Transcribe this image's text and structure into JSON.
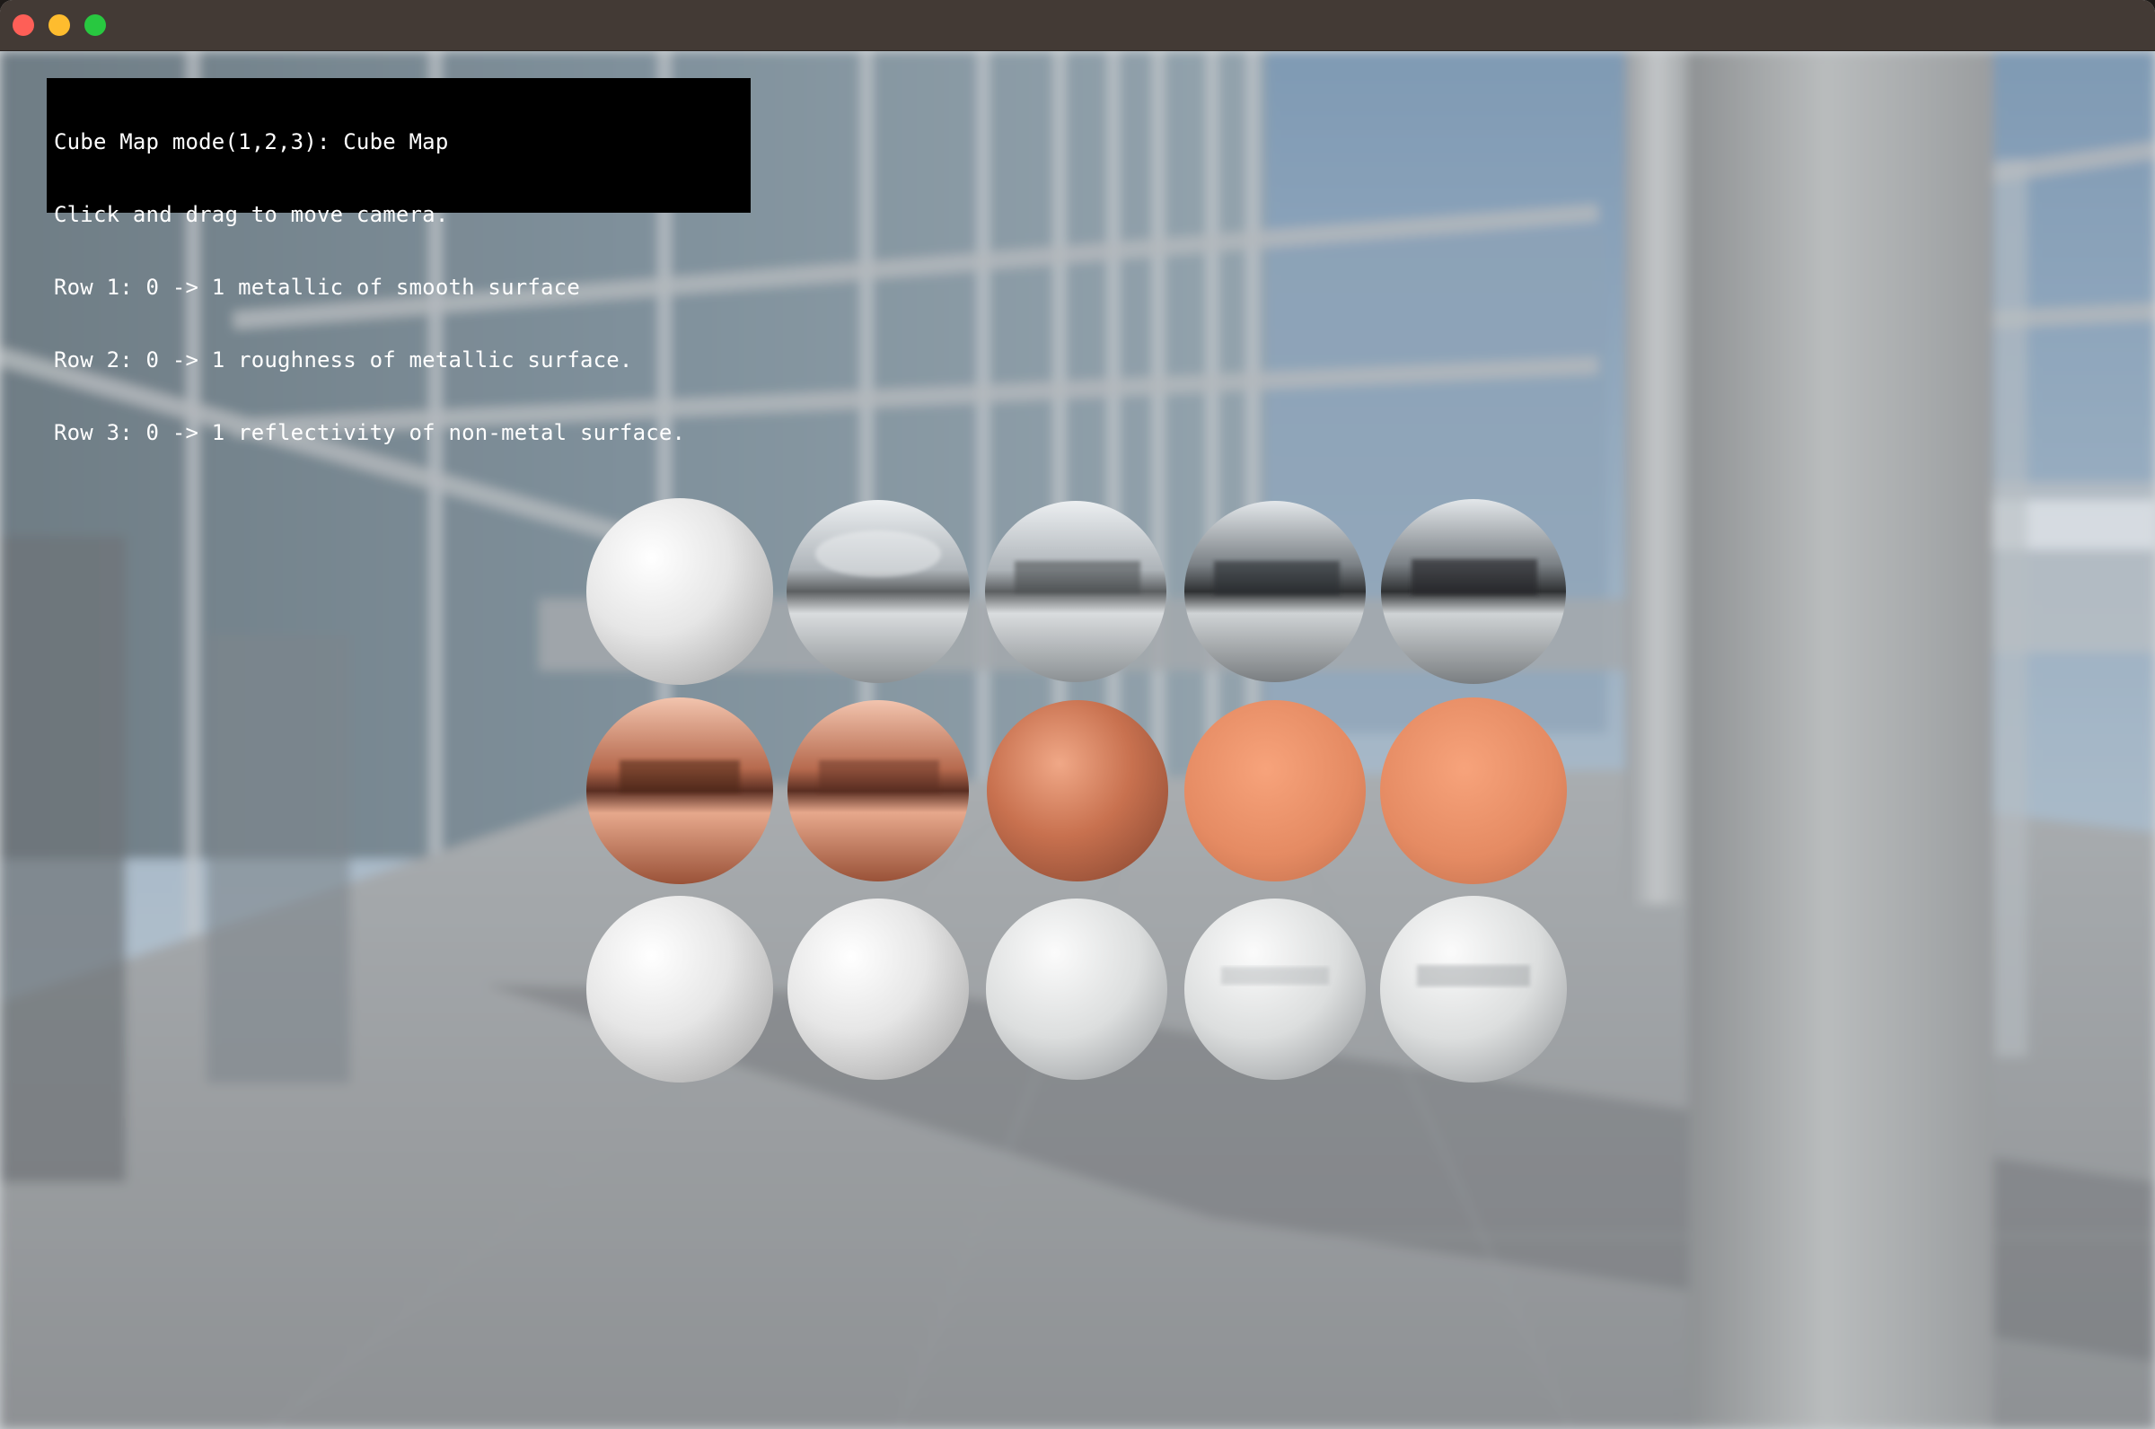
{
  "window": {
    "controls": {
      "close_color": "#fe5f57",
      "minimize_color": "#febc2e",
      "zoom_color": "#28c840"
    }
  },
  "overlay": {
    "lines": [
      "Cube Map mode(1,2,3): Cube Map",
      "Click and drag to move camera.",
      "Row 1: 0 -> 1 metallic of smooth surface",
      "Row 2: 0 -> 1 roughness of metallic surface.",
      "Row 3: 0 -> 1 reflectivity of non-metal surface."
    ]
  },
  "scene": {
    "spheres": [
      {
        "row": 1,
        "col": 1,
        "material": "smooth-white-dielectric",
        "color": "#e6e6e6",
        "metallic": 0.0
      },
      {
        "row": 1,
        "col": 2,
        "material": "chrome",
        "color": "#d5d9dc",
        "metallic": 0.25
      },
      {
        "row": 1,
        "col": 3,
        "material": "chrome",
        "color": "#c9cdd0",
        "metallic": 0.5
      },
      {
        "row": 1,
        "col": 4,
        "material": "chrome",
        "color": "#b5b9bc",
        "metallic": 0.75
      },
      {
        "row": 1,
        "col": 5,
        "material": "chrome",
        "color": "#a9adb0",
        "metallic": 1.0
      },
      {
        "row": 2,
        "col": 1,
        "material": "polished-copper",
        "color": "#c9785a",
        "roughness": 0.0
      },
      {
        "row": 2,
        "col": 2,
        "material": "polished-copper",
        "color": "#c97b5c",
        "roughness": 0.25
      },
      {
        "row": 2,
        "col": 3,
        "material": "brushed-copper",
        "color": "#d4805d",
        "roughness": 0.5
      },
      {
        "row": 2,
        "col": 4,
        "material": "matte-copper",
        "color": "#e58d66",
        "roughness": 0.75
      },
      {
        "row": 2,
        "col": 5,
        "material": "matte-copper",
        "color": "#eb9068",
        "roughness": 1.0
      },
      {
        "row": 3,
        "col": 1,
        "material": "white-dielectric",
        "color": "#e7e7e7",
        "reflectivity": 0.0
      },
      {
        "row": 3,
        "col": 2,
        "material": "white-dielectric",
        "color": "#e2e2e2",
        "reflectivity": 0.25
      },
      {
        "row": 3,
        "col": 3,
        "material": "white-dielectric",
        "color": "#dcdcdc",
        "reflectivity": 0.5
      },
      {
        "row": 3,
        "col": 4,
        "material": "white-dielectric",
        "color": "#d8dadb",
        "reflectivity": 0.75
      },
      {
        "row": 3,
        "col": 5,
        "material": "white-dielectric",
        "color": "#d3d5d7",
        "reflectivity": 1.0
      }
    ]
  }
}
